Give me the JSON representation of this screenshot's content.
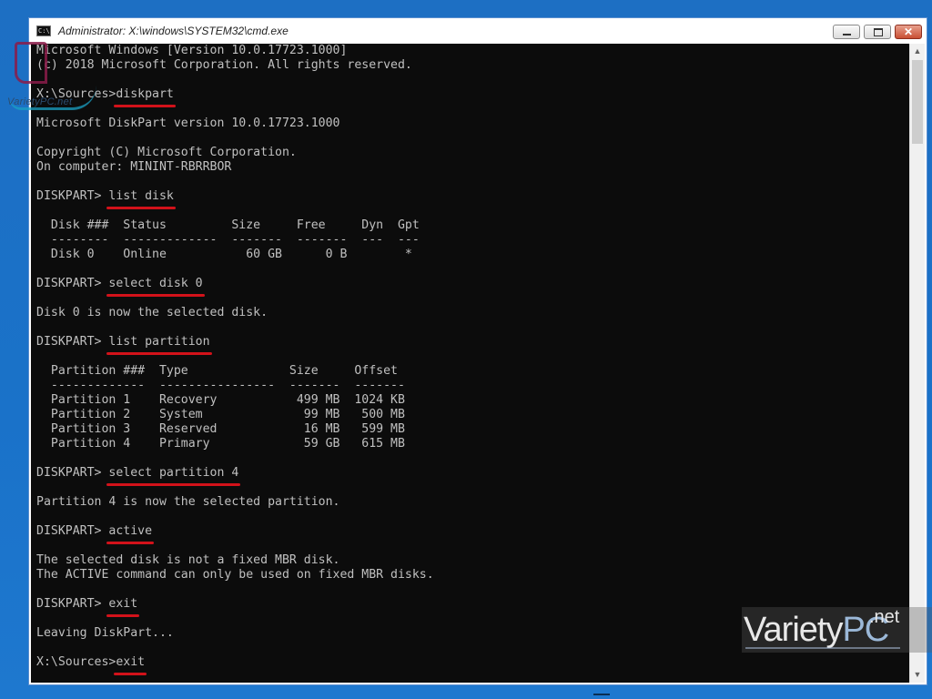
{
  "window": {
    "title": "Administrator: X:\\windows\\SYSTEM32\\cmd.exe",
    "icon": "cmd-icon",
    "controls": {
      "minimize": "minimize-icon",
      "maximize": "maximize-icon",
      "close": "close-icon",
      "close_label": "✕"
    }
  },
  "terminal": {
    "lines": [
      {
        "text": "Microsoft Windows [Version 10.0.17723.1000]"
      },
      {
        "text": "(c) 2018 Microsoft Corporation. All rights reserved."
      },
      {
        "text": ""
      },
      {
        "prompt": "X:\\Sources>",
        "command": "diskpart"
      },
      {
        "text": ""
      },
      {
        "text": "Microsoft DiskPart version 10.0.17723.1000"
      },
      {
        "text": ""
      },
      {
        "text": "Copyright (C) Microsoft Corporation."
      },
      {
        "text": "On computer: MININT-RBRRBOR"
      },
      {
        "text": ""
      },
      {
        "prompt": "DISKPART> ",
        "command": "list disk"
      },
      {
        "text": ""
      },
      {
        "text": "  Disk ###  Status         Size     Free     Dyn  Gpt"
      },
      {
        "text": "  --------  -------------  -------  -------  ---  ---"
      },
      {
        "text": "  Disk 0    Online           60 GB      0 B        *"
      },
      {
        "text": ""
      },
      {
        "prompt": "DISKPART> ",
        "command": "select disk 0"
      },
      {
        "text": ""
      },
      {
        "text": "Disk 0 is now the selected disk."
      },
      {
        "text": ""
      },
      {
        "prompt": "DISKPART> ",
        "command": "list partition"
      },
      {
        "text": ""
      },
      {
        "text": "  Partition ###  Type              Size     Offset"
      },
      {
        "text": "  -------------  ----------------  -------  -------"
      },
      {
        "text": "  Partition 1    Recovery           499 MB  1024 KB"
      },
      {
        "text": "  Partition 2    System              99 MB   500 MB"
      },
      {
        "text": "  Partition 3    Reserved            16 MB   599 MB"
      },
      {
        "text": "  Partition 4    Primary             59 GB   615 MB"
      },
      {
        "text": ""
      },
      {
        "prompt": "DISKPART> ",
        "command": "select partition 4"
      },
      {
        "text": ""
      },
      {
        "text": "Partition 4 is now the selected partition."
      },
      {
        "text": ""
      },
      {
        "prompt": "DISKPART> ",
        "command": "active"
      },
      {
        "text": ""
      },
      {
        "text": "The selected disk is not a fixed MBR disk."
      },
      {
        "text": "The ACTIVE command can only be used on fixed MBR disks."
      },
      {
        "text": ""
      },
      {
        "prompt": "DISKPART> ",
        "command": "exit"
      },
      {
        "text": ""
      },
      {
        "text": "Leaving DiskPart..."
      },
      {
        "text": ""
      },
      {
        "prompt": "X:\\Sources>",
        "command": "exit"
      }
    ],
    "highlight_color": "#d2121a",
    "text_color": "#c0c0c0",
    "background_color": "#0c0c0c"
  },
  "scrollbar": {
    "up_icon": "▲",
    "down_icon": "▼"
  },
  "watermarks": {
    "top_left": "VarietyPC.net",
    "bottom_right": {
      "variety": "Variety",
      "pc": "PC",
      "net": ".net"
    }
  },
  "colors": {
    "desktop": "#1a72c9"
  }
}
